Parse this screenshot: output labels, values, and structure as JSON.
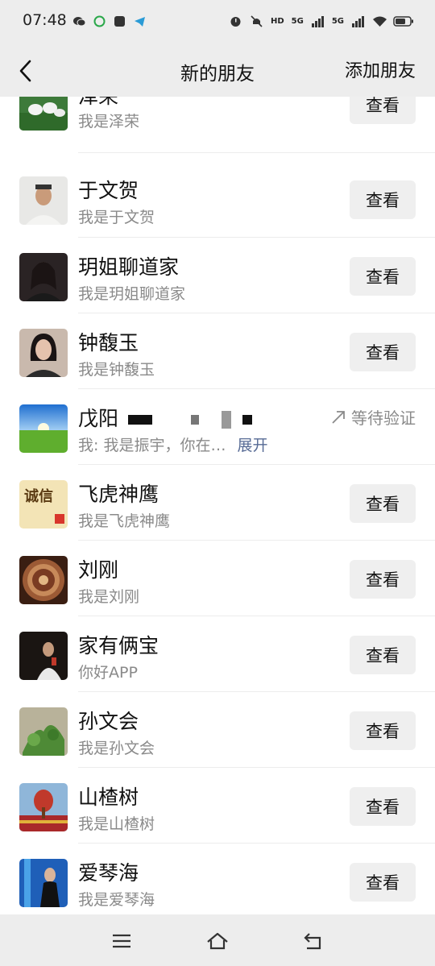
{
  "status_bar": {
    "time": "07:48",
    "signal_labels": [
      "5G",
      "5G"
    ],
    "hd_label": "HD"
  },
  "header": {
    "title": "新的朋友",
    "add_friend_label": "添加朋友"
  },
  "friends": [
    {
      "name": "泽荣",
      "message": "我是泽荣",
      "action": "查看"
    },
    {
      "name": "于文贺",
      "message": "我是于文贺",
      "action": "查看"
    },
    {
      "name": "玥姐聊道家",
      "message": "我是玥姐聊道家",
      "action": "查看"
    },
    {
      "name": "钟馥玉",
      "message": "我是钟馥玉",
      "action": "查看"
    },
    {
      "name": "戊阳",
      "message": "我: 我是振宇，你在…",
      "expand": "展开",
      "status": "等待验证"
    },
    {
      "name": "飞虎神鹰",
      "message": "我是飞虎神鹰",
      "action": "查看",
      "avatar_text": "诚信"
    },
    {
      "name": "刘刚",
      "message": "我是刘刚",
      "action": "查看"
    },
    {
      "name": "家有俩宝",
      "message": "你好APP",
      "action": "查看"
    },
    {
      "name": "孙文会",
      "message": "我是孙文会",
      "action": "查看"
    },
    {
      "name": "山楂树",
      "message": "我是山楂树",
      "action": "查看"
    },
    {
      "name": "爱琴海",
      "message": "我是爱琴海",
      "action": "查看"
    }
  ],
  "colors": {
    "header_bg": "#ededed",
    "button_bg": "#efefef",
    "link": "#576b95",
    "secondary_text": "#8a8a8a"
  },
  "icons": {
    "back": "chevron-left-icon",
    "pending": "arrow-up-right-icon",
    "menu": "menu-icon",
    "home": "home-icon",
    "back_gesture": "return-icon"
  }
}
